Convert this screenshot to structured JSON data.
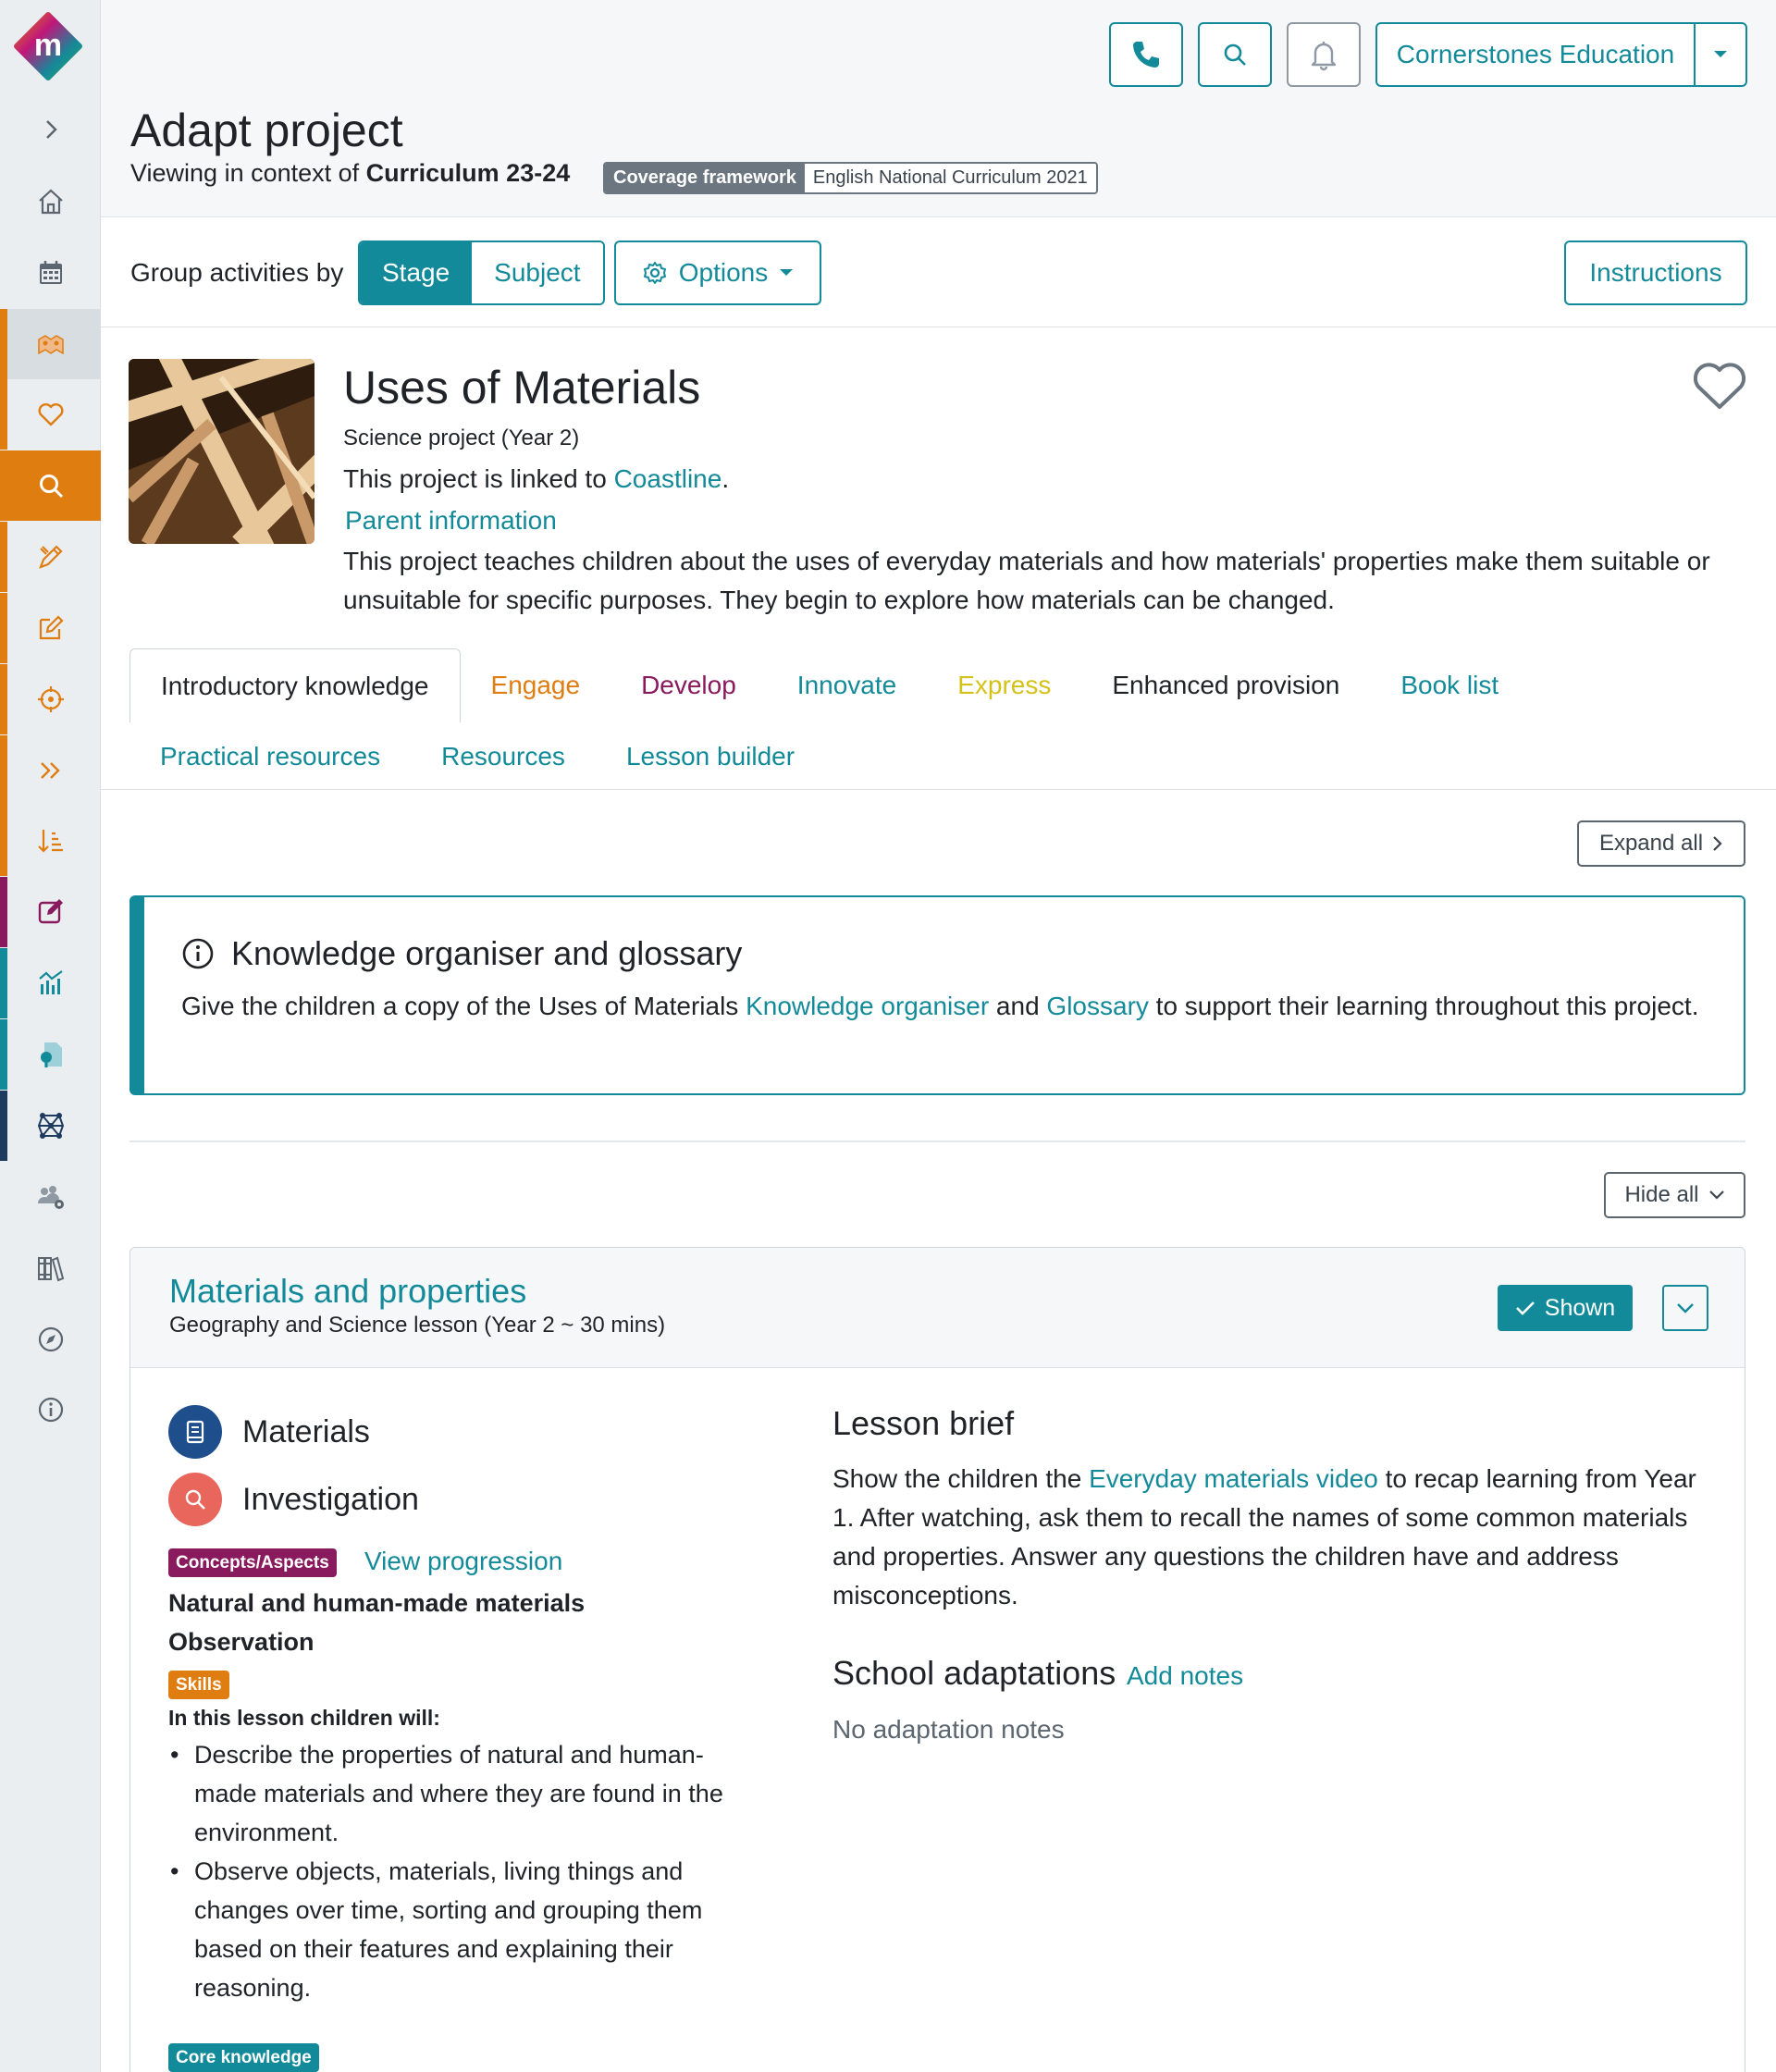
{
  "header": {
    "org_name": "Cornerstones Education",
    "page_title": "Adapt project",
    "context_prefix": "Viewing in context of ",
    "context_curriculum": "Curriculum 23-24",
    "coverage_key": "Coverage framework",
    "coverage_value": "English National Curriculum 2021"
  },
  "toolbar": {
    "group_label": "Group activities by",
    "group_options": [
      "Stage",
      "Subject"
    ],
    "group_selected": "Stage",
    "options_label": "Options",
    "instructions_label": "Instructions"
  },
  "project": {
    "title": "Uses of Materials",
    "subtitle": "Science project (Year 2)",
    "linked_prefix": "This project is linked to ",
    "linked_name": "Coastline",
    "linked_suffix": ".",
    "parent_info": "Parent information",
    "description": "This project teaches children about the uses of everyday materials and how materials' properties make them suitable or unsuitable for specific purposes. They begin to explore how materials can be changed."
  },
  "tabs": {
    "row1": [
      {
        "label": "Introductory knowledge",
        "color": "#1f2328",
        "active": true
      },
      {
        "label": "Engage",
        "color": "#e07d10"
      },
      {
        "label": "Develop",
        "color": "#8a1a5e"
      },
      {
        "label": "Innovate",
        "color": "#138a99"
      },
      {
        "label": "Express",
        "color": "#d4c21a"
      },
      {
        "label": "Enhanced provision",
        "color": "#1f2328"
      },
      {
        "label": "Book list",
        "color": "#138a99"
      }
    ],
    "row2": [
      {
        "label": "Practical resources",
        "color": "#138a99"
      },
      {
        "label": "Resources",
        "color": "#138a99"
      },
      {
        "label": "Lesson builder",
        "color": "#138a99"
      }
    ]
  },
  "expand_all_label": "Expand all",
  "hide_all_label": "Hide all",
  "knowledge": {
    "title": "Knowledge organiser and glossary",
    "text_1": "Give the children a copy of the Uses of Materials ",
    "link_1": "Knowledge organiser",
    "text_2": " and ",
    "link_2": "Glossary",
    "text_3": " to support their learning throughout this project."
  },
  "lesson": {
    "title": "Materials and properties",
    "subtitle": "Geography and Science lesson (Year 2 ~ 30 mins)",
    "shown_label": "Shown",
    "subjects": [
      {
        "label": "Materials",
        "color": "#1f4e8c",
        "icon": "book-icon"
      },
      {
        "label": "Investigation",
        "color": "#e8665c",
        "icon": "magnifier-icon"
      }
    ],
    "concepts_badge": "Concepts/Aspects",
    "concepts_color": "#8a1a5e",
    "view_progression": "View progression",
    "concepts": [
      "Natural and human-made materials",
      "Observation"
    ],
    "skills_badge": "Skills",
    "skills_color": "#e07d10",
    "in_lesson_label": "In this lesson children will:",
    "objectives": [
      "Describe the properties of natural and human-made materials and where they are found in the environment.",
      "Observe objects, materials, living things and changes over time, sorting and grouping them based on their features and explaining their reasoning."
    ],
    "core_badge": "Core knowledge",
    "core_color": "#138a99",
    "brief_heading": "Lesson brief",
    "brief_text_1": "Show the children the ",
    "brief_link": "Everyday materials video",
    "brief_text_2": " to recap learning from Year 1. After watching, ask them to recall the names of some common materials and properties. Answer any questions the children have and address misconceptions.",
    "adaptations_heading": "School adaptations",
    "add_notes": "Add notes",
    "no_notes": "No adaptation notes"
  },
  "colors": {
    "accent": "#138a99",
    "sidebar_orange": "#e07d10",
    "sidebar_magenta": "#8a1a5e",
    "sidebar_teal": "#138a99",
    "sidebar_navy": "#1f3a5f"
  },
  "sidebar_icons": [
    "expand-chevron-icon",
    "home-icon",
    "calendar-icon",
    "projects-icon",
    "heart-icon",
    "search-icon",
    "design-icon",
    "edit-icon",
    "target-icon",
    "fast-forward-icon",
    "sort-icon",
    "assessment-edit-icon",
    "chart-icon",
    "document-icon",
    "network-icon",
    "users-icon",
    "library-icon",
    "compass-icon",
    "info-icon"
  ]
}
